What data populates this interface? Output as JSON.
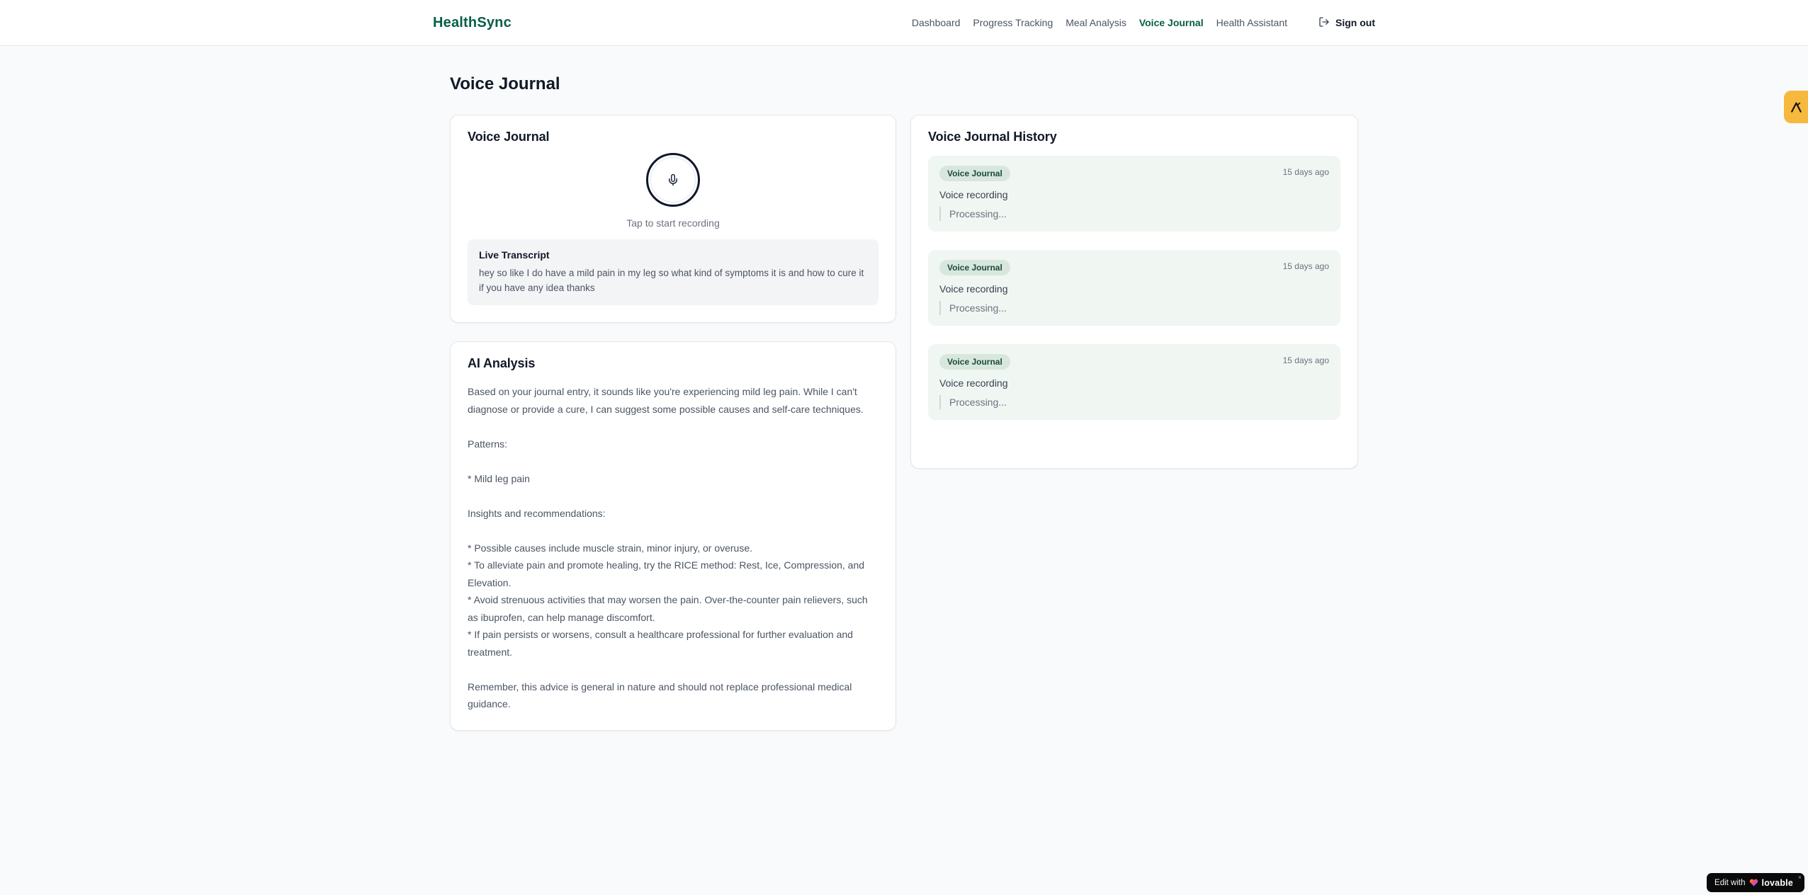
{
  "brand": {
    "name": "HealthSync",
    "color": "#065f46"
  },
  "nav": {
    "items": [
      {
        "label": "Dashboard",
        "active": false
      },
      {
        "label": "Progress Tracking",
        "active": false
      },
      {
        "label": "Meal Analysis",
        "active": false
      },
      {
        "label": "Voice Journal",
        "active": true
      },
      {
        "label": "Health Assistant",
        "active": false
      }
    ],
    "signout_label": "Sign out"
  },
  "page": {
    "title": "Voice Journal",
    "background": "#f9fafb"
  },
  "recorder_card": {
    "title": "Voice Journal",
    "mic_icon": "microphone-icon",
    "tap_hint": "Tap to start recording",
    "live_transcript": {
      "title": "Live Transcript",
      "text": "hey so like I do have a mild pain in my leg so what kind of symptoms it is and how to cure it if you have any idea thanks"
    }
  },
  "analysis_card": {
    "title": "AI Analysis",
    "body": "Based on your journal entry, it sounds like you're experiencing mild leg pain. While I can't diagnose or provide a cure, I can suggest some possible causes and self-care techniques.\n\nPatterns:\n\n* Mild leg pain\n\nInsights and recommendations:\n\n* Possible causes include muscle strain, minor injury, or overuse.\n* To alleviate pain and promote healing, try the RICE method: Rest, Ice, Compression, and Elevation.\n* Avoid strenuous activities that may worsen the pain. Over-the-counter pain relievers, such as ibuprofen, can help manage discomfort.\n* If pain persists or worsens, consult a healthcare professional for further evaluation and treatment.\n\nRemember, this advice is general in nature and should not replace professional medical guidance."
  },
  "history_card": {
    "title": "Voice Journal History",
    "entries": [
      {
        "badge": "Voice Journal",
        "time": "15 days ago",
        "label": "Voice recording",
        "status": "Processing..."
      },
      {
        "badge": "Voice Journal",
        "time": "15 days ago",
        "label": "Voice recording",
        "status": "Processing..."
      },
      {
        "badge": "Voice Journal",
        "time": "15 days ago",
        "label": "Voice recording",
        "status": "Processing..."
      }
    ]
  },
  "floating": {
    "side_badge_icon": "logo-mark-icon",
    "side_badge_color": "#f6b93d"
  },
  "lovable": {
    "prefix": "Edit with",
    "brand": "lovable",
    "close": "×"
  }
}
